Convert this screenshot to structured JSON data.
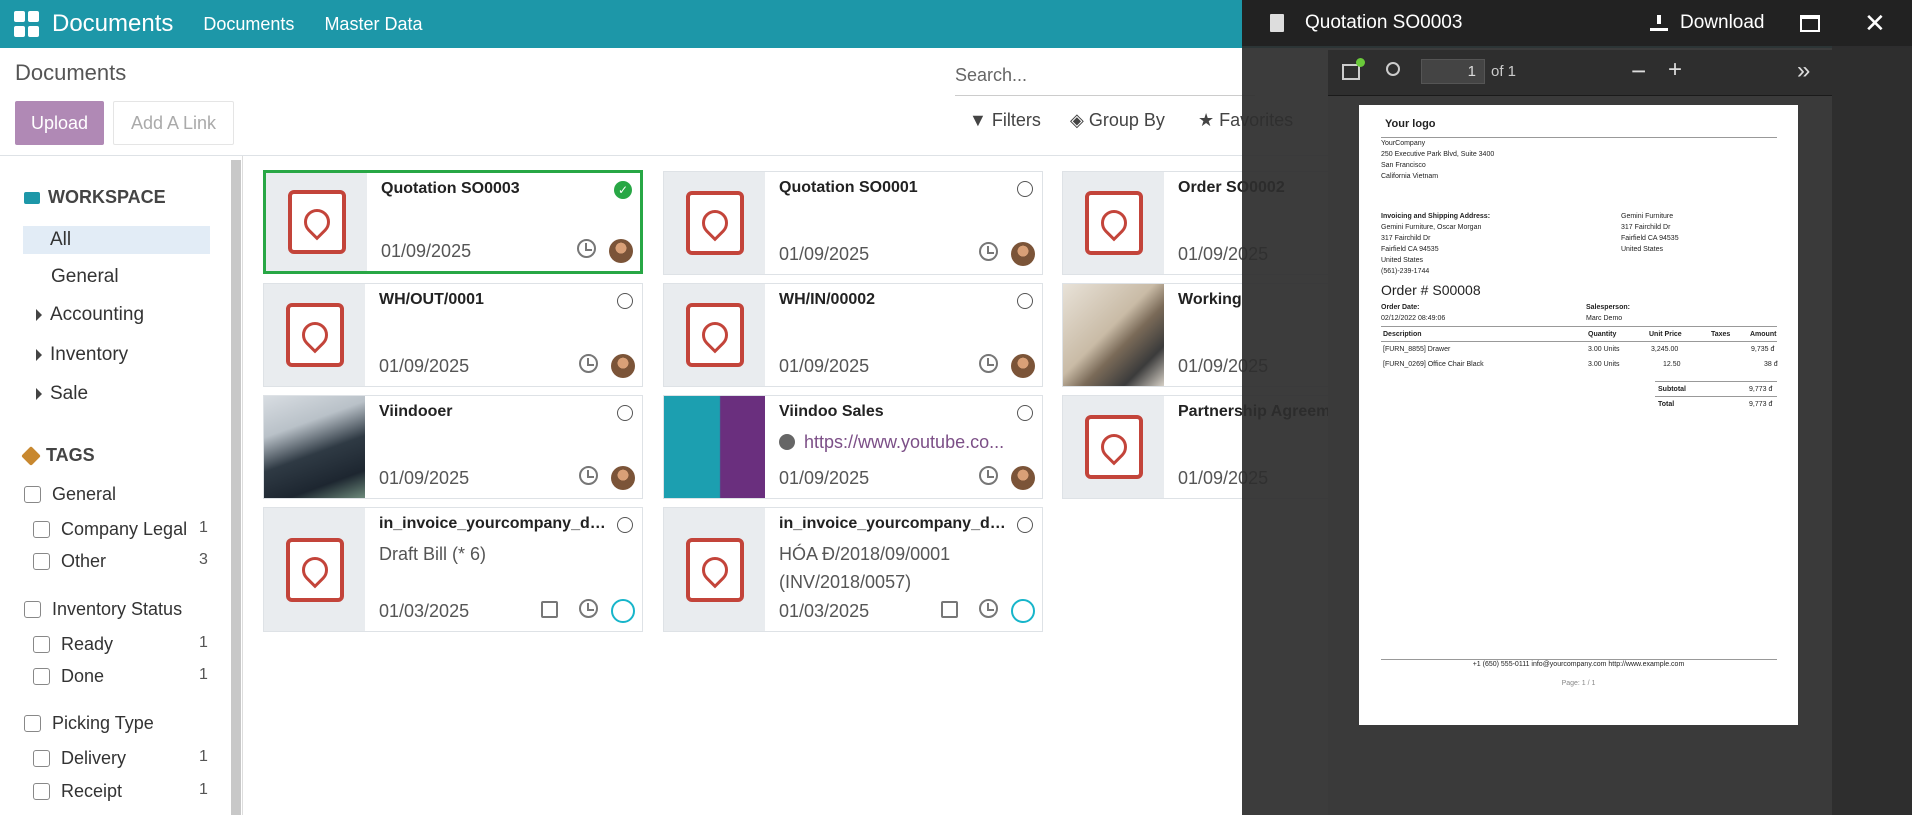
{
  "navbar": {
    "brand": "Documents",
    "menu": [
      "Documents",
      "Master Data"
    ]
  },
  "control_panel": {
    "breadcrumb": "Documents",
    "upload_label": "Upload",
    "add_link_label": "Add A Link",
    "search_placeholder": "Search...",
    "filters_label": "Filters",
    "group_by_label": "Group By",
    "favorites_label": "Favorites"
  },
  "sidebar": {
    "workspace_title": "WORKSPACE",
    "workspaces": [
      "All",
      "General",
      "Accounting",
      "Inventory",
      "Sale"
    ],
    "tags_title": "TAGS",
    "tag_groups": [
      {
        "name": "General",
        "tags": [
          {
            "label": "Company Legal",
            "count": "1"
          },
          {
            "label": "Other",
            "count": "3"
          }
        ]
      },
      {
        "name": "Inventory Status",
        "tags": [
          {
            "label": "Ready",
            "count": "1"
          },
          {
            "label": "Done",
            "count": "1"
          }
        ]
      },
      {
        "name": "Picking Type",
        "tags": [
          {
            "label": "Delivery",
            "count": "1"
          },
          {
            "label": "Receipt",
            "count": "1"
          }
        ]
      }
    ]
  },
  "documents": [
    {
      "title": "Quotation SO0003",
      "date": "01/09/2025"
    },
    {
      "title": "Quotation SO0001",
      "date": "01/09/2025"
    },
    {
      "title": "Order SO0002",
      "date": "01/09/2025"
    },
    {
      "title": "WH/OUT/0001",
      "date": "01/09/2025"
    },
    {
      "title": "WH/IN/00002",
      "date": "01/09/2025"
    },
    {
      "title": "Working",
      "date": "01/09/2025"
    },
    {
      "title": "Viindooer",
      "date": "01/09/2025"
    },
    {
      "title": "Viindoo Sales",
      "sub": "https://www.youtube.co...",
      "date": "01/09/2025"
    },
    {
      "title": "Partnership Agreeme",
      "date": "01/09/2025"
    },
    {
      "title": "in_invoice_yourcompany_dem...",
      "sub": "Draft Bill (* 6)",
      "date": "01/03/2025"
    },
    {
      "title": "in_invoice_yourcompany_dem...",
      "sub": "HÓA Đ/2018/09/0001 (INV/2018/0057)",
      "date": "01/03/2025"
    }
  ],
  "viewer": {
    "title": "Quotation SO0003",
    "download_label": "Download",
    "page_number": "1",
    "page_total": "of 1",
    "pdf": {
      "logo": "Your logo",
      "company": [
        "YourCompany",
        "250 Executive Park Blvd, Suite 3400",
        "San Francisco",
        "California Vietnam"
      ],
      "invoice_address_title": "Invoicing and Shipping Address:",
      "invoice_address": [
        "Gemini Furniture, Oscar Morgan",
        "317 Fairchild Dr",
        "Fairfield CA 94535",
        "United States",
        "(561)-239-1744"
      ],
      "partner_address": [
        "Gemini Furniture",
        "317 Fairchild Dr",
        "Fairfield CA 94535",
        "United States"
      ],
      "order_title": "Order # S00008",
      "order_date_label": "Order Date:",
      "order_date": "02/12/2022 08:49:06",
      "salesperson_label": "Salesperson:",
      "salesperson": "Marc Demo",
      "columns": [
        "Description",
        "Quantity",
        "Unit Price",
        "Taxes",
        "Amount"
      ],
      "lines": [
        [
          "[FURN_8855] Drawer",
          "3.00 Units",
          "3,245.00",
          "",
          "9,735 đ"
        ],
        [
          "[FURN_0269] Office Chair Black",
          "3.00 Units",
          "12.50",
          "",
          "38 đ"
        ]
      ],
      "subtotal_label": "Subtotal",
      "subtotal": "9,773 đ",
      "total_label": "Total",
      "total": "9,773 đ",
      "footer": "+1 (650) 555-0111   info@yourcompany.com   http://www.example.com",
      "page_footer": "Page: 1 / 1"
    }
  }
}
